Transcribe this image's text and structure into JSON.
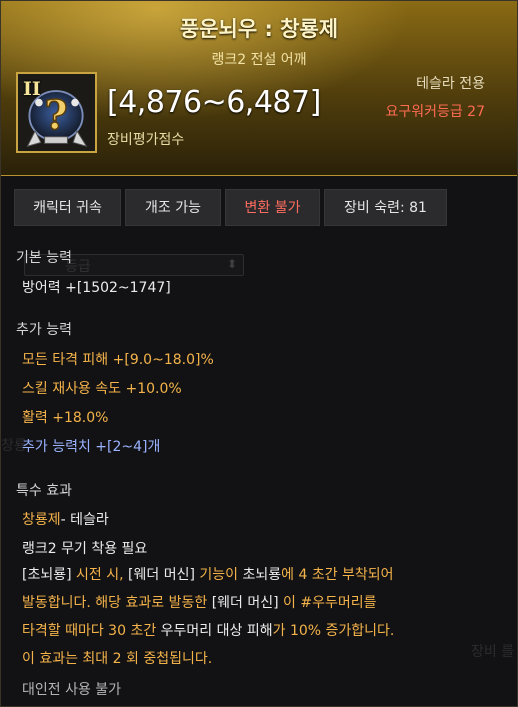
{
  "header": {
    "title": "풍운뇌우 : 창룡제",
    "subtitle": "랭크2 전설 어깨",
    "rank_badge": "II",
    "score": "[4,876~6,487]",
    "score_label": "장비평가점수",
    "class_label": "테슬라 전용",
    "requirement": "요구워커등급 27"
  },
  "tags": [
    {
      "label": "캐릭터 귀속",
      "color": "#e6e6e6"
    },
    {
      "label": "개조 가능",
      "color": "#e6e6e6"
    },
    {
      "label": "변환 불가",
      "color": "#ff6d5e"
    },
    {
      "label": "장비 숙련: 81",
      "color": "#e6e6e6"
    }
  ],
  "basic": {
    "heading": "기본 능력",
    "defense": "방어력  +[1502~1747]"
  },
  "extra": {
    "heading": "추가 능력",
    "items": [
      "모든 타격 피해  +[9.0~18.0]%",
      "스킬 재사용 속도  +10.0%",
      "활력  +18.0%"
    ],
    "extra_value": "추가 능력치 +[2~4]개"
  },
  "special": {
    "heading": "특수 효과",
    "set_name": "창룡제",
    "set_suffix": "- 테슬라",
    "weapon_req": "랭크2 무기 착용 필요",
    "effect": {
      "p1": "[초뇌룡]",
      "p2": " 시전 시, ",
      "p3": "[웨더 머신]",
      "p4": " 기능이 ",
      "p5": "초뇌룡",
      "p6": "에 4 초간 부착되어",
      "p7": "발동합니다. 해당 효과로 발동한 ",
      "p8": "[웨더 머신]",
      "p9": " 이 #우두머리를",
      "p10": "타격할 때마다 30 초간 ",
      "p11": "우두머리 대상 피해",
      "p12": "가 10% 증가합니다.",
      "p13": "이 효과는 최대 2 회 중첩됩니다."
    },
    "pvp_note": "대인전 사용 불가"
  },
  "background_ghost": {
    "select_text": "등급",
    "side_text": "창룡",
    "side_text_right": "장비 를"
  },
  "colors": {
    "accent_gold": "#c9a541",
    "highlight_orange": "#f4b34a",
    "warning_red": "#ff6d5e",
    "extra_blue": "#9ab2ff"
  }
}
